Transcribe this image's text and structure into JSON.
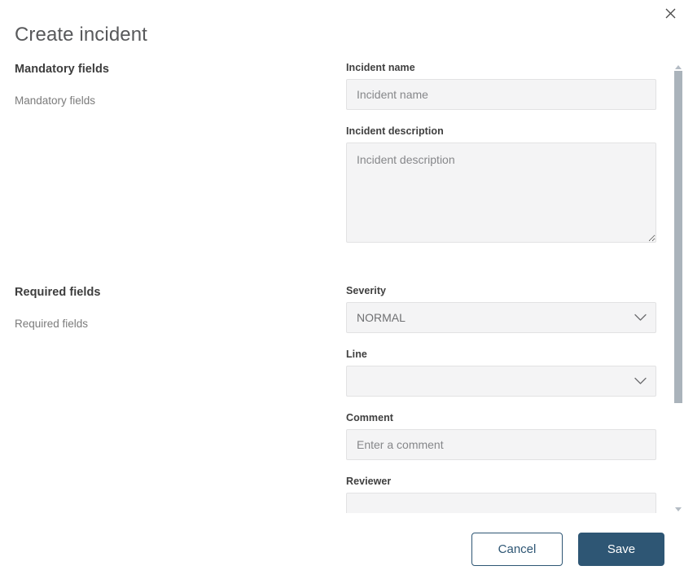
{
  "dialog": {
    "title": "Create incident",
    "close_icon": "close-icon"
  },
  "sections": {
    "mandatory": {
      "heading": "Mandatory fields",
      "subtext": "Mandatory fields"
    },
    "required": {
      "heading": "Required fields",
      "subtext": "Required fields"
    }
  },
  "fields": {
    "incident_name": {
      "label": "Incident name",
      "placeholder": "Incident name",
      "value": ""
    },
    "incident_description": {
      "label": "Incident description",
      "placeholder": "Incident description",
      "value": ""
    },
    "severity": {
      "label": "Severity",
      "value": "NORMAL",
      "options": [
        "NORMAL"
      ],
      "chevron_icon": "chevron-down-icon"
    },
    "line": {
      "label": "Line",
      "value": "",
      "options": [],
      "chevron_icon": "chevron-down-icon"
    },
    "comment": {
      "label": "Comment",
      "placeholder": "Enter a comment",
      "value": ""
    },
    "reviewer": {
      "label": "Reviewer",
      "placeholder": "",
      "value": ""
    }
  },
  "scrollbar": {
    "up_icon": "caret-up-icon",
    "down_icon": "caret-down-icon"
  },
  "footer": {
    "cancel_label": "Cancel",
    "save_label": "Save"
  },
  "colors": {
    "accent": "#2e5674",
    "field_bg": "#f4f4f5",
    "field_border": "#e2e2e3",
    "scrollbar_thumb": "#aab3bb",
    "title_text": "#58595b"
  }
}
